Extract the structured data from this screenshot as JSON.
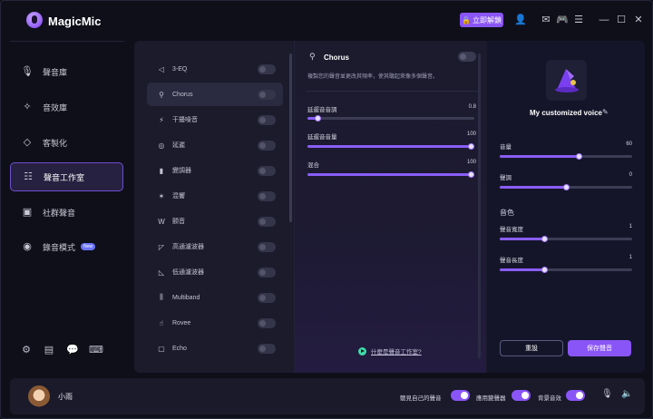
{
  "app": {
    "title": "MagicMic",
    "unlock_label": "立即解鎖"
  },
  "sidebar": {
    "items": [
      {
        "label": "聲音庫",
        "icon": "microphone-icon"
      },
      {
        "label": "音效庫",
        "icon": "sparkle-icon"
      },
      {
        "label": "客製化",
        "icon": "diamond-icon"
      },
      {
        "label": "聲音工作室",
        "icon": "sliders-icon",
        "active": true
      },
      {
        "label": "社群聲音",
        "icon": "community-icon"
      },
      {
        "label": "錄音模式",
        "icon": "record-icon",
        "badge": "New"
      }
    ]
  },
  "effects": [
    {
      "label": "3-EQ",
      "icon": "eq-icon"
    },
    {
      "label": "Chorus",
      "icon": "chorus-icon",
      "selected": true
    },
    {
      "label": "干擾噪音",
      "icon": "noise-icon"
    },
    {
      "label": "延遲",
      "icon": "delay-icon"
    },
    {
      "label": "變調器",
      "icon": "pitch-icon"
    },
    {
      "label": "混響",
      "icon": "reverb-icon"
    },
    {
      "label": "顫音",
      "icon": "vibrato-icon"
    },
    {
      "label": "高通濾波器",
      "icon": "highpass-icon"
    },
    {
      "label": "低通濾波器",
      "icon": "lowpass-icon"
    },
    {
      "label": "Multiband",
      "icon": "multiband-icon"
    },
    {
      "label": "Rovee",
      "icon": "hand-icon"
    },
    {
      "label": "Echo",
      "icon": "echo-icon"
    }
  ],
  "chorus": {
    "title": "Chorus",
    "description": "複製您的聲音並更改其頻率，使其聽起來像多個聲音。",
    "sliders": [
      {
        "label": "延遲音音調",
        "value": "0.8",
        "fraction": 0.06
      },
      {
        "label": "延遲音音量",
        "value": "100",
        "fraction": 1.0
      },
      {
        "label": "混合",
        "value": "100",
        "fraction": 1.0
      }
    ],
    "help_link": "什麼是聲音工作室?"
  },
  "voice": {
    "name": "My customized voice",
    "sliders": [
      {
        "label": "音量",
        "value": "60",
        "fraction": 0.6
      },
      {
        "label": "聲調",
        "value": "0",
        "fraction": 0.5
      }
    ],
    "timbre_label": "音色",
    "timbre_sliders": [
      {
        "label": "聲音寬度",
        "value": "1",
        "fraction": 0.34
      },
      {
        "label": "聲音長度",
        "value": "1",
        "fraction": 0.34
      }
    ],
    "reset_label": "重設",
    "save_label": "保存聲音"
  },
  "bottom": {
    "username": "小雨",
    "hear_self_label": "聽見自己的聲音",
    "changer_label": "應用變聲器",
    "bg_effect_label": "背景音效"
  },
  "colors": {
    "accent": "#8a55f7",
    "background": "#0f0f1a",
    "panel": "#1a1a2b"
  }
}
